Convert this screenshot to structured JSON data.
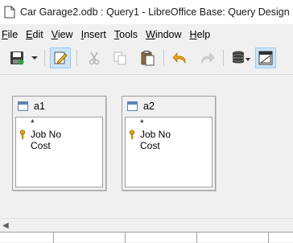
{
  "window": {
    "title": "Car Garage2.odb : Query1 - LibreOffice Base: Query Design"
  },
  "menubar": {
    "items": [
      {
        "label": "File",
        "mnemonic": "F",
        "rest": "ile"
      },
      {
        "label": "Edit",
        "mnemonic": "E",
        "rest": "dit"
      },
      {
        "label": "View",
        "mnemonic": "V",
        "rest": "iew"
      },
      {
        "label": "Insert",
        "mnemonic": "I",
        "rest": "nsert"
      },
      {
        "label": "Tools",
        "mnemonic": "T",
        "rest": "ools"
      },
      {
        "label": "Window",
        "mnemonic": "W",
        "rest": "indow"
      },
      {
        "label": "Help",
        "mnemonic": "H",
        "rest": "elp"
      }
    ]
  },
  "toolbar": {
    "buttons": [
      {
        "name": "save-icon",
        "state": "normal"
      },
      {
        "name": "save-dropdown-icon",
        "state": "normal"
      },
      {
        "name": "edit-mode-icon",
        "state": "active"
      },
      {
        "name": "cut-icon",
        "state": "disabled"
      },
      {
        "name": "copy-icon",
        "state": "disabled"
      },
      {
        "name": "paste-icon",
        "state": "normal"
      },
      {
        "name": "undo-icon",
        "state": "normal"
      },
      {
        "name": "redo-icon",
        "state": "disabled"
      },
      {
        "name": "run-query-icon",
        "state": "normal"
      },
      {
        "name": "design-view-icon",
        "state": "active"
      }
    ]
  },
  "tables": [
    {
      "name": "a1",
      "fields": [
        {
          "label": "*",
          "primary_key": false
        },
        {
          "label": "Job No",
          "primary_key": true
        },
        {
          "label": "Cost",
          "primary_key": false
        }
      ]
    },
    {
      "name": "a2",
      "fields": [
        {
          "label": "*",
          "primary_key": false
        },
        {
          "label": "Job No",
          "primary_key": true
        },
        {
          "label": "Cost",
          "primary_key": false
        }
      ]
    }
  ],
  "colors": {
    "active_button_bg": "#cce4f7",
    "key_icon": "#e8a317",
    "table_icon": "#5b84b1"
  }
}
